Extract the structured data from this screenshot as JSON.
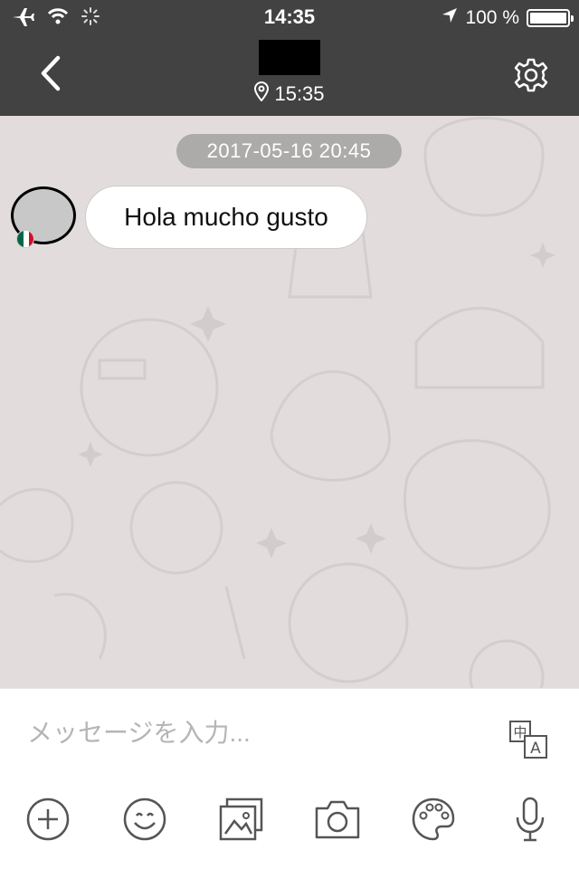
{
  "status_bar": {
    "time": "14:35",
    "battery_text": "100 %",
    "battery_level": 1.0,
    "icons": [
      "airplane-icon",
      "wifi-icon",
      "activity-spinner-icon",
      "location-arrow-icon",
      "battery-icon"
    ]
  },
  "header": {
    "subtitle_time": "15:35",
    "icons": [
      "back-chevron-icon",
      "location-pin-icon",
      "gear-icon"
    ]
  },
  "chat": {
    "date_label": "2017-05-16 20:45",
    "messages": [
      {
        "direction": "incoming",
        "text": "Hola mucho gusto"
      }
    ]
  },
  "input": {
    "placeholder": "メッセージを入力..."
  },
  "toolbar": {
    "items": [
      "plus-icon",
      "emoji-icon",
      "gallery-icon",
      "camera-icon",
      "palette-icon",
      "microphone-icon"
    ]
  },
  "colors": {
    "header_bg": "#424242",
    "chat_bg": "#e2dcdc",
    "bubble_bg": "#ffffff",
    "icon_gray": "#555555"
  }
}
